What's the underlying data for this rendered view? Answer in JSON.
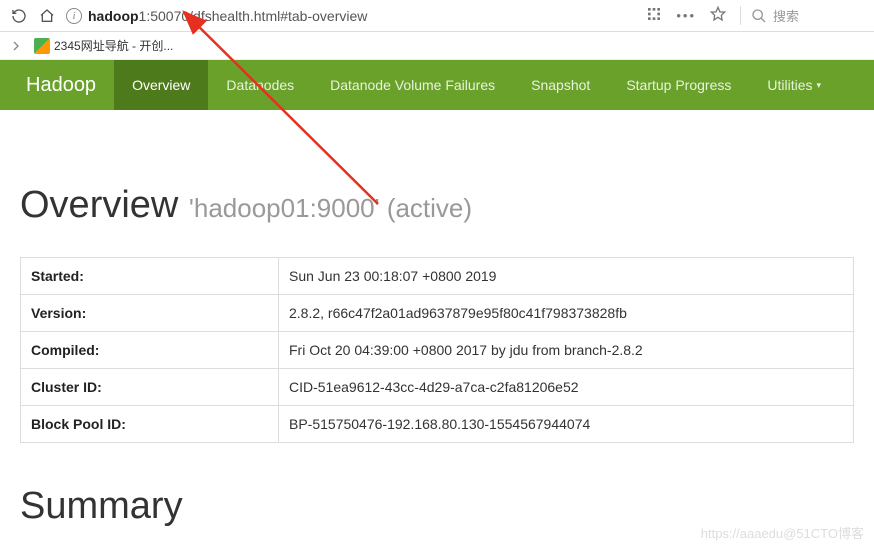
{
  "browser": {
    "url_prefix": "hadoop",
    "url_mid": "1",
    "url_rest": ":50070/dfshealth.html#tab-overview",
    "search_placeholder": "搜索"
  },
  "bookmarks": {
    "item1": "2345网址导航 - 开创..."
  },
  "nav": {
    "brand": "Hadoop",
    "items": [
      "Overview",
      "Datanodes",
      "Datanode Volume Failures",
      "Snapshot",
      "Startup Progress",
      "Utilities"
    ]
  },
  "overview": {
    "title_prefix": "Overview ",
    "title_sub": "'hadoop01:9000' (active)"
  },
  "summary": {
    "title": "Summary"
  },
  "table": {
    "rows": [
      {
        "label": "Started:",
        "value": "Sun Jun 23 00:18:07 +0800 2019"
      },
      {
        "label": "Version:",
        "value": "2.8.2, r66c47f2a01ad9637879e95f80c41f798373828fb"
      },
      {
        "label": "Compiled:",
        "value": "Fri Oct 20 04:39:00 +0800 2017 by jdu from branch-2.8.2"
      },
      {
        "label": "Cluster ID:",
        "value": "CID-51ea9612-43cc-4d29-a7ca-c2fa81206e52"
      },
      {
        "label": "Block Pool ID:",
        "value": "BP-515750476-192.168.80.130-1554567944074"
      }
    ]
  },
  "watermark": "https://aaaedu@51CTO博客"
}
